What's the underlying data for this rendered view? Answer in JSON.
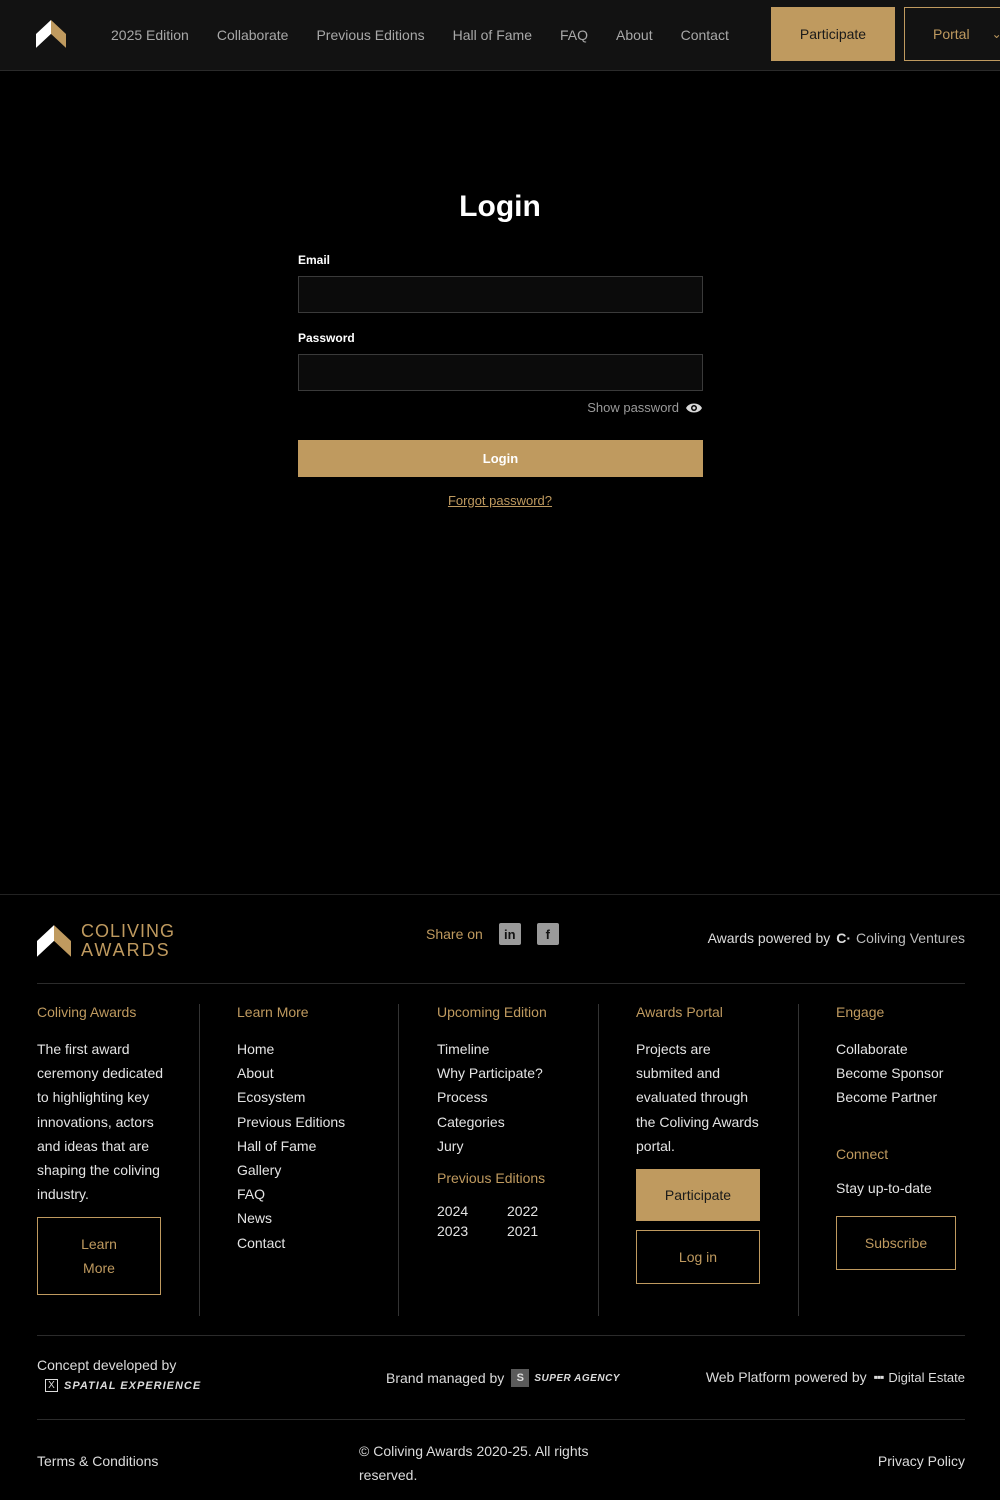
{
  "header": {
    "nav": [
      "2025 Edition",
      "Collaborate",
      "Previous Editions",
      "Hall of Fame",
      "FAQ",
      "About",
      "Contact"
    ],
    "participate_label": "Participate",
    "portal_label": "Portal"
  },
  "login": {
    "title": "Login",
    "email_label": "Email",
    "email_value": "",
    "password_label": "Password",
    "password_value": "",
    "show_password_label": "Show password",
    "submit_label": "Login",
    "forgot_label": "Forgot password?"
  },
  "footer": {
    "logo_line1": "COLIVING",
    "logo_line2": "AWARDS",
    "share_label": "Share on",
    "powered_label": "Awards powered by",
    "powered_brand": "Coliving Ventures",
    "col1": {
      "heading": "Coliving Awards",
      "text": "The first award ceremony dedicated to highlighting key innovations, actors and ideas that are shaping the coliving industry.",
      "button": "Learn More"
    },
    "col2": {
      "heading": "Learn More",
      "links": [
        "Home",
        "About",
        "Ecosystem",
        "Previous Editions",
        "Hall of Fame",
        "Gallery",
        "FAQ",
        "News",
        "Contact"
      ]
    },
    "col3": {
      "heading": "Upcoming Edition",
      "links": [
        "Timeline",
        "Why Participate?",
        "Process",
        "Categories",
        "Jury"
      ],
      "prev_heading": "Previous Editions",
      "years": [
        "2024",
        "2022",
        "2023",
        "2021"
      ]
    },
    "col4": {
      "heading": "Awards Portal",
      "text": "Projects are submited and evaluated through the Coliving Awards portal.",
      "participate": "Participate",
      "login": "Log in"
    },
    "col5": {
      "heading": "Engage",
      "links": [
        "Collaborate",
        "Become Sponsor",
        "Become Partner"
      ],
      "connect_heading": "Connect",
      "connect_text": "Stay up-to-date",
      "subscribe": "Subscribe"
    },
    "concept_label": "Concept developed by",
    "concept_brand": "SPATIAL EXPERIENCE",
    "brand_label": "Brand managed by",
    "brand_name": "SUPER AGENCY",
    "platform_label": "Web Platform powered by",
    "platform_name": "Digital Estate",
    "terms": "Terms & Conditions",
    "copyright": "© Coliving Awards 2020-25. All rights reserved.",
    "privacy": "Privacy Policy"
  }
}
